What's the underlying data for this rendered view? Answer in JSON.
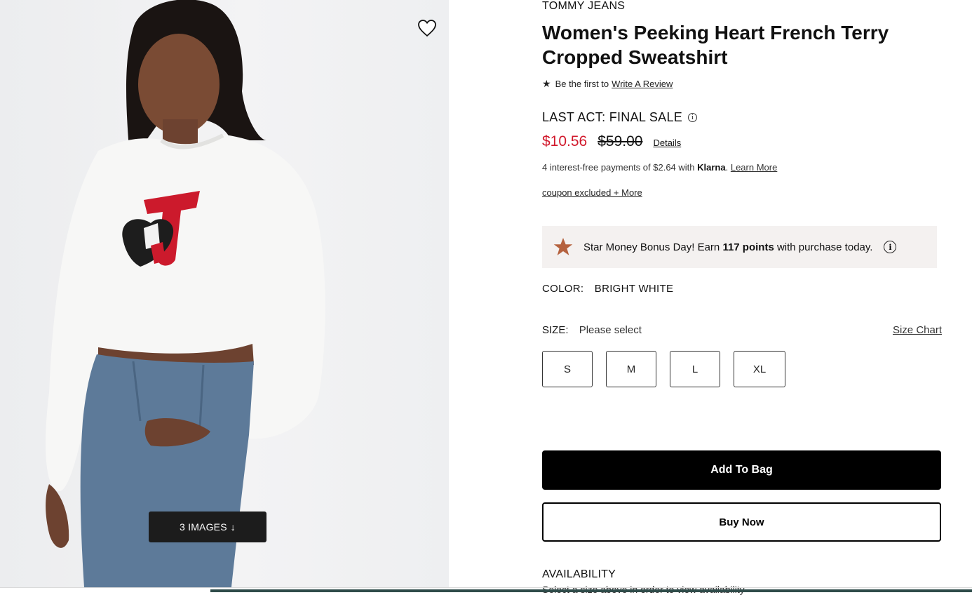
{
  "product": {
    "brand": "TOMMY JEANS",
    "title": "Women's Peeking Heart French Terry Cropped Sweatshirt",
    "review_prefix": "Be the first to",
    "review_link": "Write A Review",
    "sale_label": "LAST ACT: FINAL SALE",
    "price_sale": "$10.56",
    "price_original": "$59.00",
    "price_details": "Details",
    "klarna_text": "4 interest-free payments of $2.64 with",
    "klarna_brand": "Klarna",
    "klarna_link": "Learn More",
    "coupon_text": "coupon excluded + More",
    "image_count_label": "3 IMAGES"
  },
  "bonus": {
    "text_before": "Star Money Bonus Day! Earn",
    "points": "117 points",
    "text_after": "with purchase today."
  },
  "color": {
    "label": "COLOR:",
    "value": "BRIGHT WHITE"
  },
  "size": {
    "label": "SIZE:",
    "value": "Please select",
    "chart_link": "Size Chart",
    "options": [
      "S",
      "M",
      "L",
      "XL"
    ]
  },
  "actions": {
    "add_to_bag": "Add To Bag",
    "buy_now": "Buy Now"
  },
  "availability": {
    "label": "AVAILABILITY",
    "message": "Select a size above in order to view availability"
  },
  "colors": {
    "sale_red": "#d1182b",
    "bonus_bg": "#f4f1f0",
    "star_bronze": "#b5623f"
  },
  "icons": {
    "favorite": "heart-outline-icon",
    "bonus": "star-icon",
    "info": "info-icon",
    "down": "arrow-down-icon"
  }
}
